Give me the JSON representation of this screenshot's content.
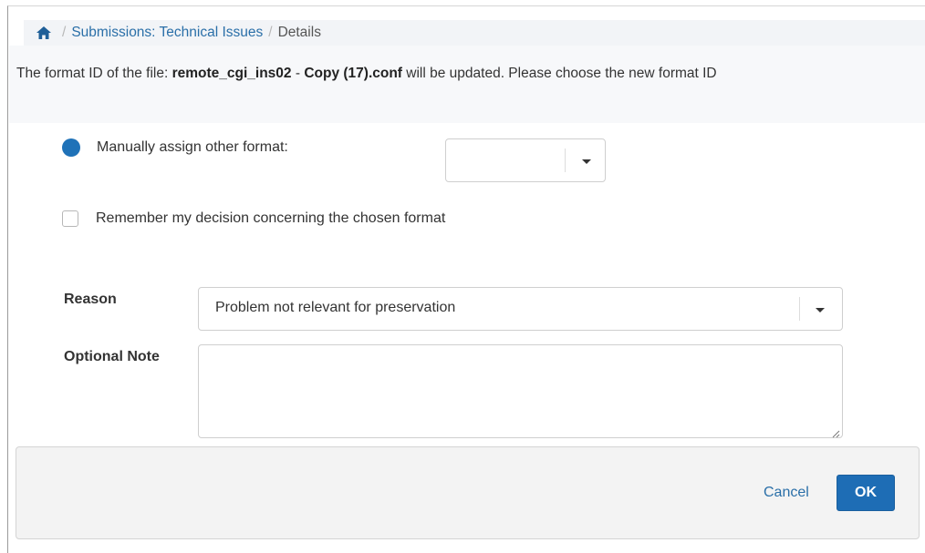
{
  "breadcrumb": {
    "items": [
      {
        "label": "Submissions: Technical Issues"
      },
      {
        "label": "Details"
      }
    ],
    "separator": "/"
  },
  "message": {
    "prefix": "The format ID of the file: ",
    "file_part1": "remote_cgi_ins02",
    "joiner": " - ",
    "file_part2": "Copy (17).conf",
    "suffix": " will be updated. Please choose the new format ID"
  },
  "form": {
    "radio_label": "Manually assign other format:",
    "format_select_value": "",
    "checkbox_label": "Remember my decision concerning the chosen format",
    "reason_label": "Reason",
    "reason_value": "Problem not relevant for preservation",
    "note_label": "Optional Note",
    "note_value": ""
  },
  "footer": {
    "cancel_label": "Cancel",
    "ok_label": "OK"
  },
  "colors": {
    "accent": "#1e6db5",
    "link": "#2a6fa8"
  }
}
